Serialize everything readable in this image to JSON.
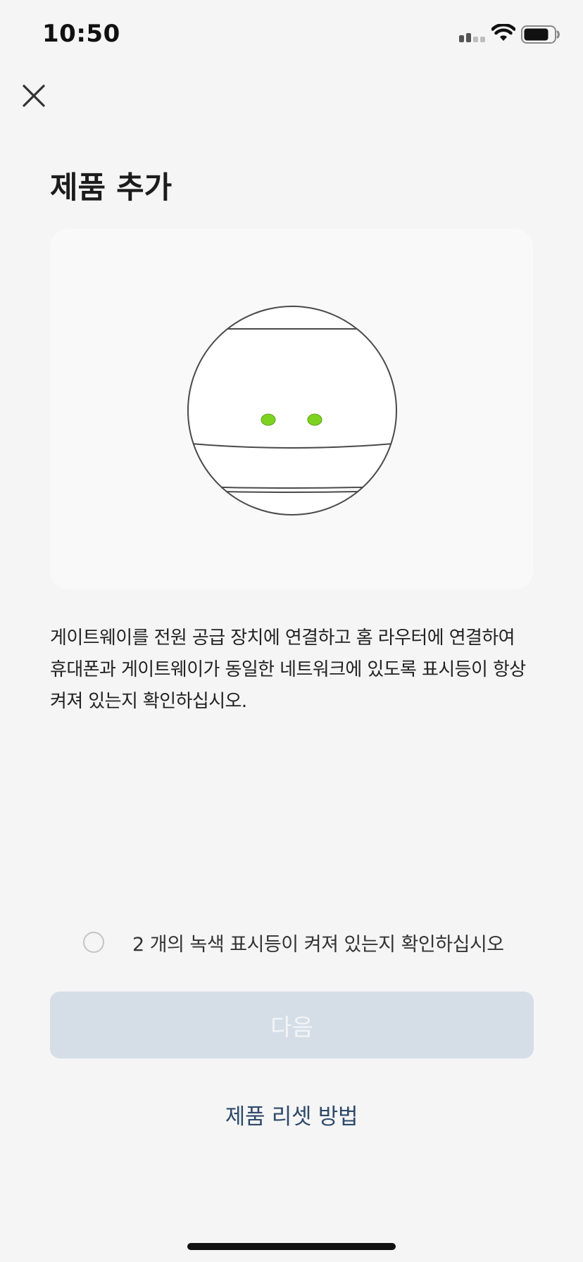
{
  "status_bar": {
    "time": "10:50",
    "icons": [
      "signal-icon",
      "wifi-icon",
      "battery-icon"
    ]
  },
  "header": {
    "close_icon": "close-icon",
    "title": "제품 추가"
  },
  "illustration": {
    "subject": "gateway-icon",
    "indicator_count": 2,
    "indicator_color": "#7ed321"
  },
  "instruction": {
    "text": "게이트웨이를 전원 공급 장치에 연결하고 홈 라우터에 연결하여 휴대폰과 게이트웨이가 동일한 네트워크에 있도록 표시등이 항상 켜져 있는지 확인하십시오."
  },
  "confirmation": {
    "label": "2 개의 녹색 표시등이 켜져 있는지 확인하십시오",
    "checked": false
  },
  "actions": {
    "next_label": "다음",
    "next_enabled": false,
    "reset_link_label": "제품 리셋 방법"
  },
  "colors": {
    "background": "#f5f5f5",
    "card_background": "#f9f9f9",
    "button_disabled": "#d5dee6",
    "link": "#2e4a6b",
    "indicator_green": "#7ed321"
  }
}
